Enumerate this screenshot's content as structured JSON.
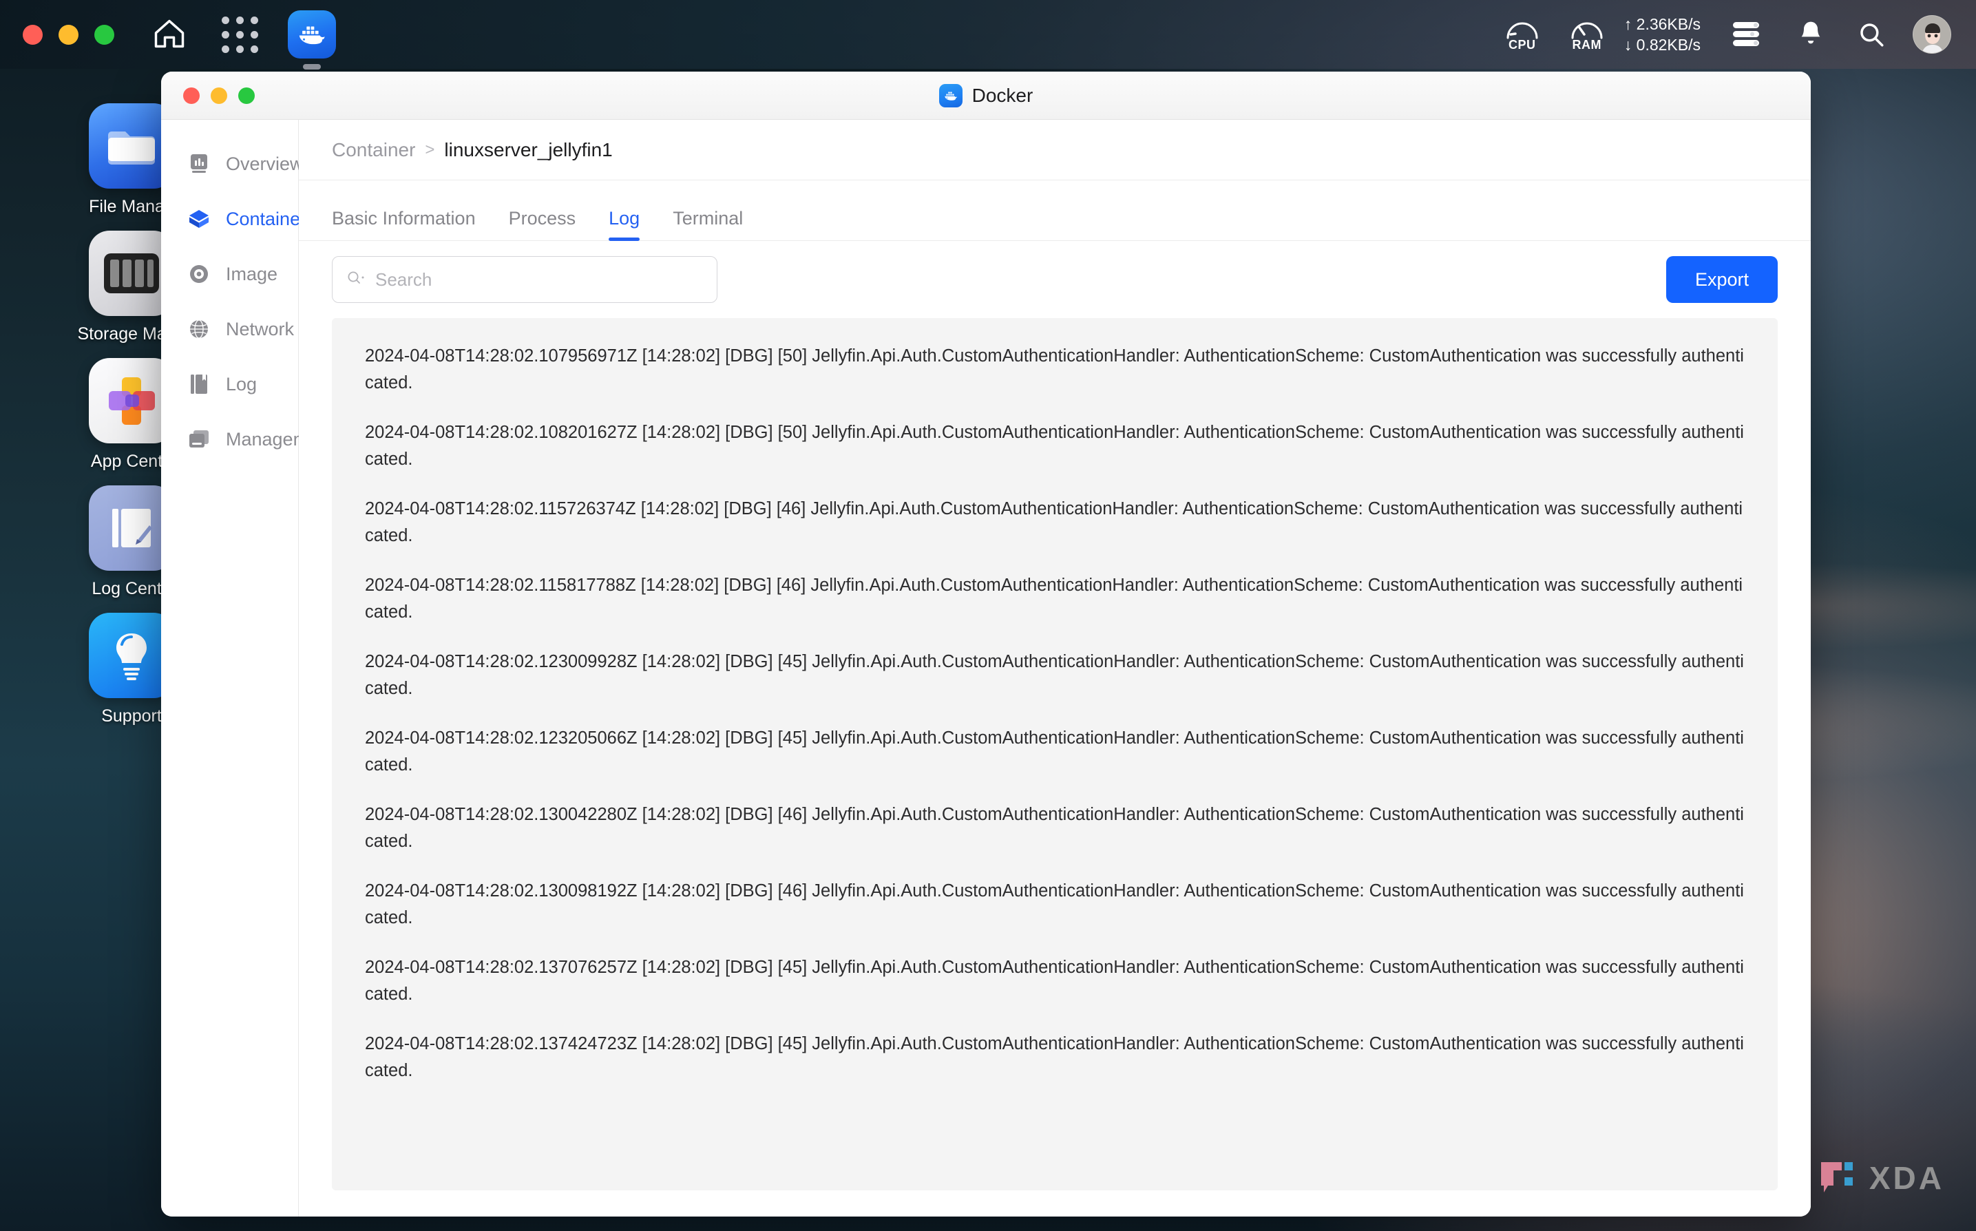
{
  "menubar": {
    "traffic_lights": [
      "close",
      "minimize",
      "maximize"
    ],
    "home_icon": "home-icon",
    "grid_icon": "app-grid-icon",
    "dock_app": {
      "name": "Docker",
      "icon": "docker-whale-icon",
      "running": true
    },
    "tray": {
      "cpu_label": "CPU",
      "ram_label": "RAM",
      "upload_rate": "↑ 2.36KB/s",
      "download_rate": "↓ 0.82KB/s",
      "server_icon": "server-stack-icon",
      "bell_icon": "notification-bell-icon",
      "search_icon": "search-icon",
      "avatar_icon": "user-avatar"
    }
  },
  "desktop_icons": [
    {
      "label": "File Manag",
      "icon": "folder-icon"
    },
    {
      "label": "Storage Mana",
      "icon": "storage-drives-icon"
    },
    {
      "label": "App Cente",
      "icon": "app-center-icon"
    },
    {
      "label": "Log Cente",
      "icon": "log-center-icon"
    },
    {
      "label": "Support",
      "icon": "lightbulb-icon"
    }
  ],
  "window": {
    "title": "Docker",
    "title_icon": "docker-whale-icon",
    "traffic_lights": [
      "close",
      "minimize",
      "maximize"
    ]
  },
  "sidebar": {
    "items": [
      {
        "label": "Overview",
        "icon": "chart-panel-icon",
        "active": false
      },
      {
        "label": "Container",
        "icon": "container-box-icon",
        "active": true
      },
      {
        "label": "Image",
        "icon": "disc-icon",
        "active": false
      },
      {
        "label": "Network",
        "icon": "globe-icon",
        "active": false
      },
      {
        "label": "Log",
        "icon": "book-icon",
        "active": false
      },
      {
        "label": "Management",
        "icon": "window-stack-icon",
        "active": false
      }
    ]
  },
  "breadcrumb": {
    "root": "Container",
    "separator": ">",
    "current": "linuxserver_jellyfin1"
  },
  "tabs": [
    {
      "label": "Basic Information",
      "active": false
    },
    {
      "label": "Process",
      "active": false
    },
    {
      "label": "Log",
      "active": true
    },
    {
      "label": "Terminal",
      "active": false
    }
  ],
  "toolbar": {
    "search_placeholder": "Search",
    "search_value": "",
    "search_icon": "search-dropdown-icon",
    "export_label": "Export"
  },
  "log_lines": [
    "2024-04-08T14:28:02.107956971Z [14:28:02] [DBG] [50] Jellyfin.Api.Auth.CustomAuthenticationHandler: AuthenticationScheme: CustomAuthentication was successfully authenticated.",
    "2024-04-08T14:28:02.108201627Z [14:28:02] [DBG] [50] Jellyfin.Api.Auth.CustomAuthenticationHandler: AuthenticationScheme: CustomAuthentication was successfully authenticated.",
    "2024-04-08T14:28:02.115726374Z [14:28:02] [DBG] [46] Jellyfin.Api.Auth.CustomAuthenticationHandler: AuthenticationScheme: CustomAuthentication was successfully authenticated.",
    "2024-04-08T14:28:02.115817788Z [14:28:02] [DBG] [46] Jellyfin.Api.Auth.CustomAuthenticationHandler: AuthenticationScheme: CustomAuthentication was successfully authenticated.",
    "2024-04-08T14:28:02.123009928Z [14:28:02] [DBG] [45] Jellyfin.Api.Auth.CustomAuthenticationHandler: AuthenticationScheme: CustomAuthentication was successfully authenticated.",
    "2024-04-08T14:28:02.123205066Z [14:28:02] [DBG] [45] Jellyfin.Api.Auth.CustomAuthenticationHandler: AuthenticationScheme: CustomAuthentication was successfully authenticated.",
    "2024-04-08T14:28:02.130042280Z [14:28:02] [DBG] [46] Jellyfin.Api.Auth.CustomAuthenticationHandler: AuthenticationScheme: CustomAuthentication was successfully authenticated.",
    "2024-04-08T14:28:02.130098192Z [14:28:02] [DBG] [46] Jellyfin.Api.Auth.CustomAuthenticationHandler: AuthenticationScheme: CustomAuthentication was successfully authenticated.",
    "2024-04-08T14:28:02.137076257Z [14:28:02] [DBG] [45] Jellyfin.Api.Auth.CustomAuthenticationHandler: AuthenticationScheme: CustomAuthentication was successfully authenticated.",
    "2024-04-08T14:28:02.137424723Z [14:28:02] [DBG] [45] Jellyfin.Api.Auth.CustomAuthenticationHandler: AuthenticationScheme: CustomAuthentication was successfully authenticated."
  ],
  "watermark": {
    "text": "XDA",
    "icon": "xda-logo-icon"
  },
  "colors": {
    "accent": "#1463ff",
    "accent_nav": "#2461f2",
    "log_bg": "#f4f4f4",
    "text_primary": "#1d1d1f",
    "text_muted": "#86868b"
  }
}
